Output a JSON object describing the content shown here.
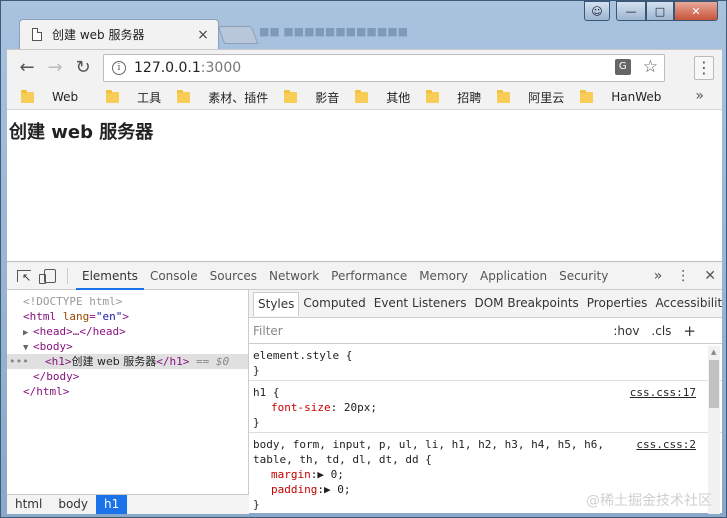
{
  "tab": {
    "title": "创建 web 服务器",
    "close": "×",
    "blurred_tab": "■■ ■■■■■■■■■■■■"
  },
  "window_buttons": {
    "user": "☺",
    "minimize": "—",
    "maximize": "□",
    "close": "✕"
  },
  "toolbar": {
    "back": "←",
    "forward": "→",
    "reload": "↻",
    "info": "i",
    "url_host": "127.0.0.1",
    "url_port": ":3000",
    "translate": "G",
    "star": "☆",
    "menu": "⋮"
  },
  "bookmarks": {
    "items": [
      "Web",
      "工具",
      "素材、插件",
      "影音",
      "其他",
      "招聘",
      "阿里云",
      "HanWeb"
    ],
    "more": "»"
  },
  "page": {
    "heading": "创建 web 服务器"
  },
  "devtools": {
    "tabs": [
      "Elements",
      "Console",
      "Sources",
      "Network",
      "Performance",
      "Memory",
      "Application",
      "Security"
    ],
    "active_tab": "Elements",
    "more": "»",
    "menu": "⋮",
    "close": "✕",
    "dom": {
      "doctype": "<!DOCTYPE html>",
      "html_open_tag": "<html",
      "html_lang_attr": " lang",
      "html_lang_eq": "=",
      "html_lang_val": "\"en\"",
      "html_open_close": ">",
      "head": "<head>…</head>",
      "body_open": "<body>",
      "h1_open": "<h1>",
      "h1_text": "创建 web 服务器",
      "h1_close": "</h1>",
      "h1_marker": " == $0",
      "body_close": "</body>",
      "html_close": "</html>",
      "dots": "•••"
    },
    "crumbs": [
      "html",
      "body",
      "h1"
    ],
    "sub_tabs": [
      "Styles",
      "Computed",
      "Event Listeners",
      "DOM Breakpoints",
      "Properties",
      "Accessibility"
    ],
    "filter": {
      "placeholder": "Filter",
      "hov": ":hov",
      "cls": ".cls",
      "plus": "+"
    },
    "rules": [
      {
        "selector": "element.style {",
        "close": "}",
        "source": "",
        "props": []
      },
      {
        "selector": "h1 {",
        "close": "}",
        "source": "css.css:17",
        "props": [
          {
            "name": "font-size",
            "value": ": 20px;"
          }
        ]
      },
      {
        "selector": "body, form, input, p, ul, li, h1, h2, h3, h4, h5, h6,",
        "selector2": "table, th, td, dl, dt, dd {",
        "close": "}",
        "source": "css.css:2",
        "props": [
          {
            "name": "margin",
            "value": ":▶ 0;"
          },
          {
            "name": "padding",
            "value": ":▶ 0;"
          }
        ]
      }
    ],
    "watermark": "@稀土掘金技术社区"
  }
}
